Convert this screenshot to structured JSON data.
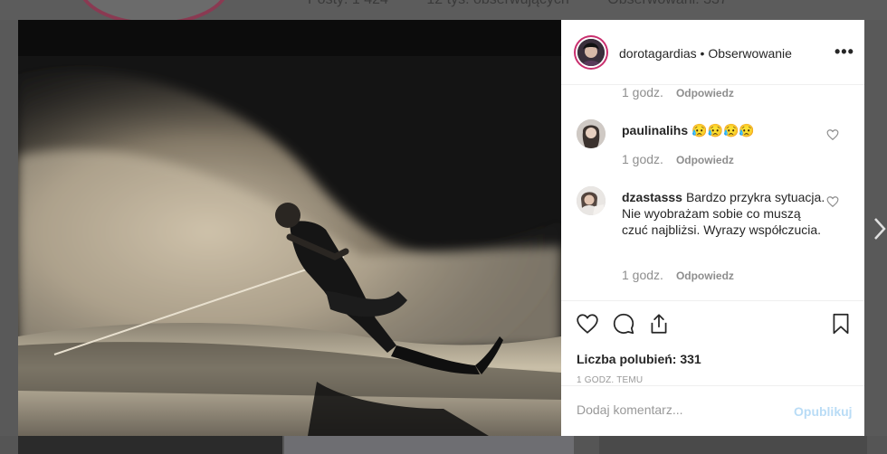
{
  "background_profile": {
    "stats": [
      "Posty: 1 424",
      "12 tys. obserwujących",
      "Obserwowani: 337"
    ]
  },
  "post": {
    "author": "dorotagardias",
    "separator": " • ",
    "follow_label": "Obserwowanie",
    "more_label": "•••",
    "comments": [
      {
        "time": "1 godz.",
        "reply_label": "Odpowiedz"
      },
      {
        "user": "paulinalihs",
        "text": "😥😥😥😥",
        "time": "1 godz.",
        "reply_label": "Odpowiedz"
      },
      {
        "user": "dzastasss",
        "text": "Bardzo przykra sytuacja. Nie wyobrażam sobie co muszą czuć najbliżsi. Wyrazy współczucia.",
        "time": "1 godz.",
        "reply_label": "Odpowiedz"
      }
    ],
    "likes_text": "Liczba polubień: 331",
    "posted_ago": "1 GODZ. TEMU",
    "comment_placeholder": "Dodaj komentarz...",
    "post_button": "Opublikuj"
  },
  "icons": {
    "like": "heart-icon",
    "comment": "comment-bubble-icon",
    "share": "share-icon",
    "save": "bookmark-icon",
    "next": "chevron-right-icon"
  },
  "colors": {
    "post_button_disabled": "#b9dcf6",
    "avatar_ring": "#c92f6e",
    "text_primary": "#262626",
    "text_secondary": "#8e8e8e"
  }
}
